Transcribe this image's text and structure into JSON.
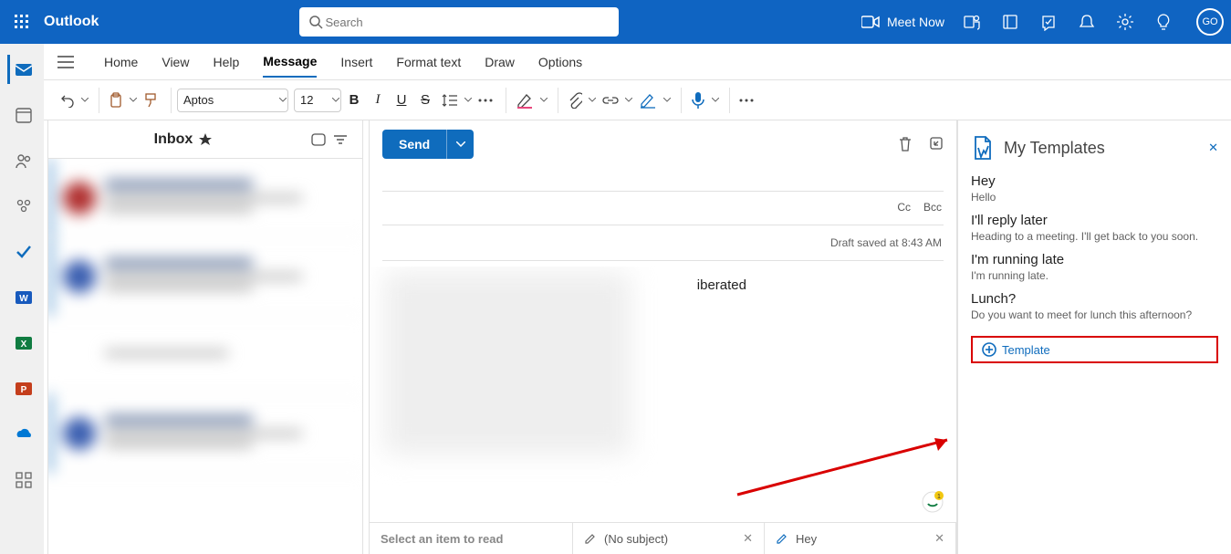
{
  "header": {
    "brand": "Outlook",
    "search_placeholder": "Search",
    "meet_label": "Meet Now",
    "avatar": "GO"
  },
  "tabs": {
    "home": "Home",
    "view": "View",
    "help": "Help",
    "message": "Message",
    "insert": "Insert",
    "format": "Format text",
    "draw": "Draw",
    "options": "Options"
  },
  "ribbon": {
    "font_name": "Aptos",
    "font_size": "12"
  },
  "inbox": {
    "title": "Inbox"
  },
  "compose": {
    "send": "Send",
    "cc": "Cc",
    "bcc": "Bcc",
    "draft_status": "Draft saved at 8:43 AM",
    "body_fragment": "iberated"
  },
  "doc_tabs": {
    "placeholder": "Select an item to read",
    "no_subject": "(No subject)",
    "hey": "Hey"
  },
  "templates": {
    "title": "My Templates",
    "items": [
      {
        "name": "Hey",
        "preview": "Hello"
      },
      {
        "name": "I'll reply later",
        "preview": "Heading to a meeting. I'll get back to you soon."
      },
      {
        "name": "I'm running late",
        "preview": "I'm running late."
      },
      {
        "name": "Lunch?",
        "preview": "Do you want to meet for lunch this afternoon?"
      }
    ],
    "add_label": "Template"
  }
}
